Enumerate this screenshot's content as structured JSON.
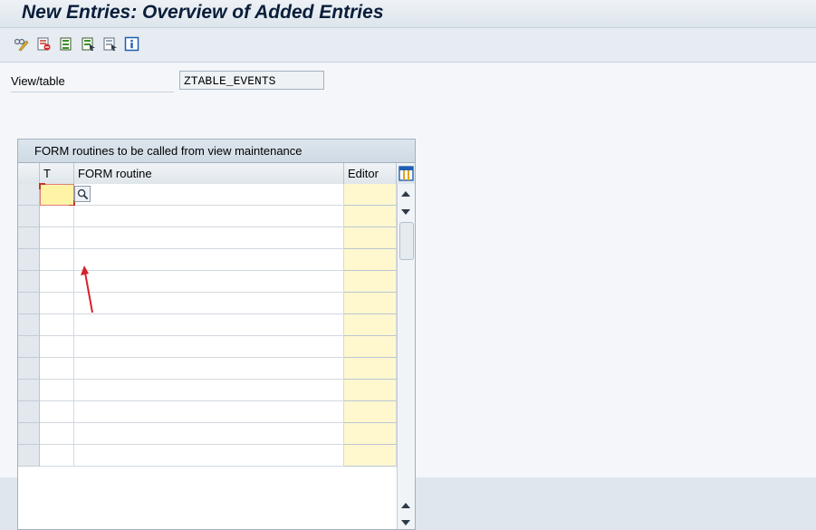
{
  "window": {
    "title": "New Entries: Overview of Added Entries"
  },
  "toolbar": {
    "icons": [
      "display-change-icon",
      "delete-row-icon",
      "select-all-icon",
      "select-block-icon",
      "deselect-all-icon",
      "info-icon"
    ]
  },
  "header_fields": {
    "view_table_label": "View/table",
    "view_table_value": "ZTABLE_EVENTS"
  },
  "table": {
    "title": "FORM routines to be called from view maintenance",
    "columns": [
      "T",
      "FORM routine",
      "Editor"
    ],
    "row_count": 13
  },
  "colors": {
    "editor_column": "#fff8cf",
    "focus_cell": "#fff4a6",
    "annotation_arrow": "#d6202a"
  }
}
